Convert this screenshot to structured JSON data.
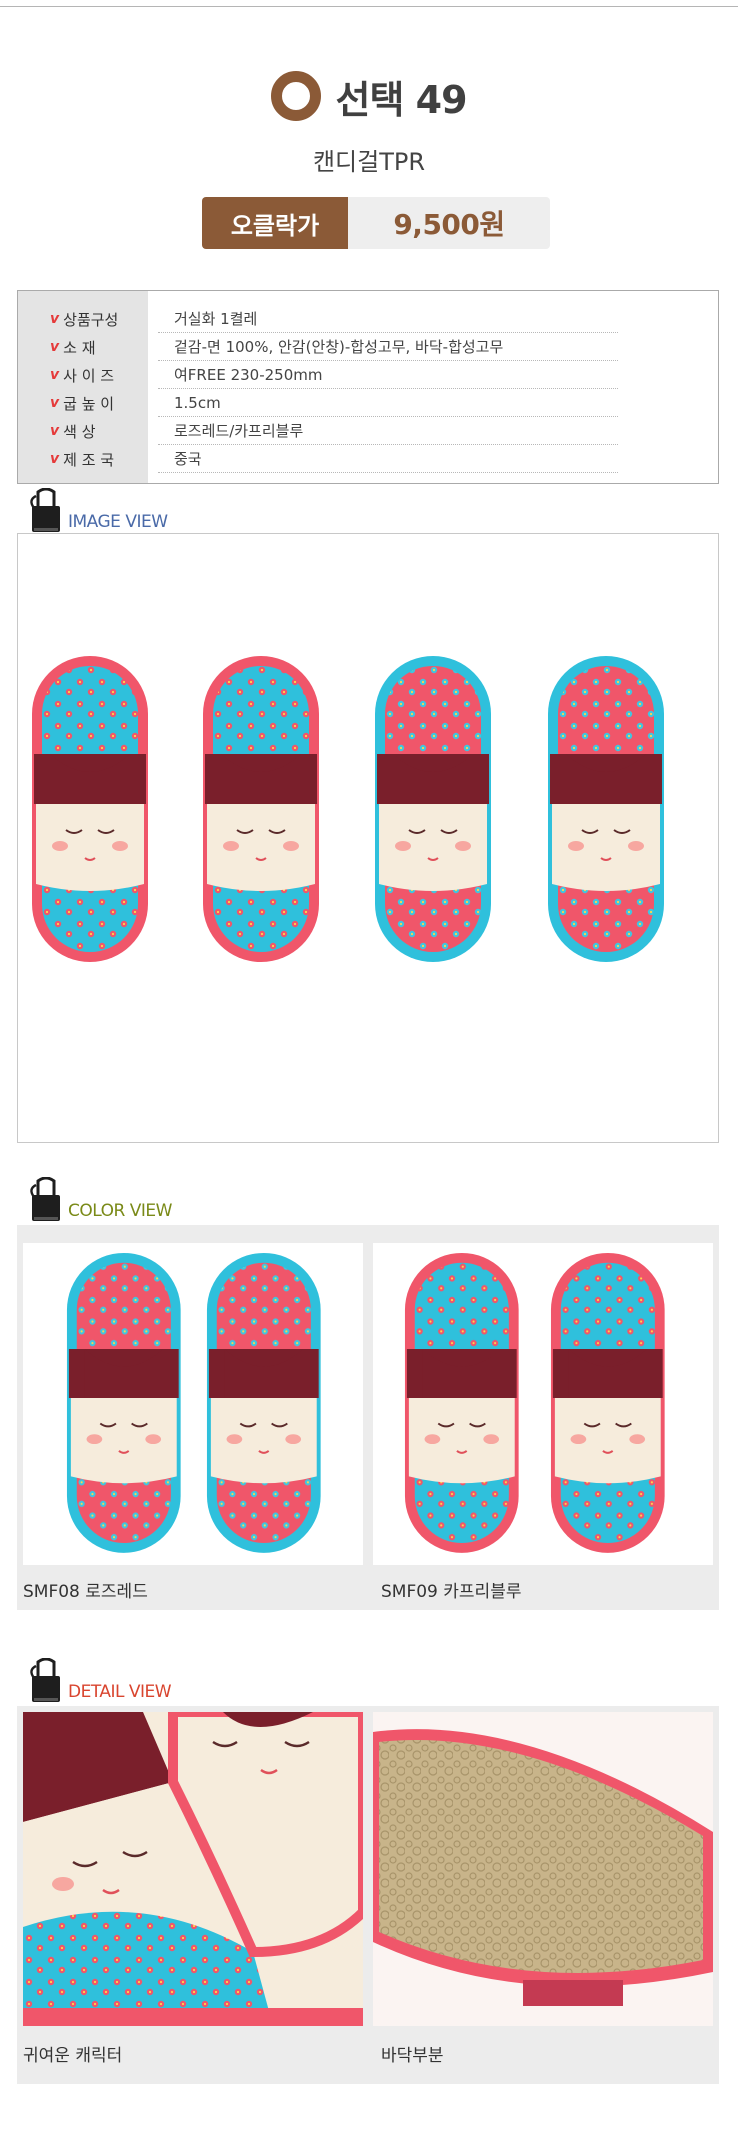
{
  "header": {
    "title": "선택 49",
    "subtitle": "캔디걸TPR",
    "price_label": "오클락가",
    "price_value": "9,500원"
  },
  "specs": [
    {
      "key": "상품구성",
      "value": "거실화 1켤레"
    },
    {
      "key": "소  재",
      "value": "겉감-면 100%, 안감(안창)-합성고무, 바닥-합성고무"
    },
    {
      "key": "사 이 즈",
      "value": "여FREE 230-250mm"
    },
    {
      "key": "굽 높 이",
      "value": "1.5cm"
    },
    {
      "key": "색  상",
      "value": "로즈레드/카프리블루"
    },
    {
      "key": "제 조 국",
      "value": "중국"
    }
  ],
  "sections": {
    "image_view": {
      "title": "IMAGE VIEW",
      "color": "#4a6aa8"
    },
    "color_view": {
      "title": "COLOR VIEW",
      "color": "#7a8a18"
    },
    "detail_view": {
      "title": "DETAIL VIEW",
      "color": "#d9452f"
    }
  },
  "color_view": [
    {
      "caption": "SMF08 로즈레드"
    },
    {
      "caption": "SMF09 카프리블루"
    }
  ],
  "detail_view": [
    {
      "caption": "귀여운 캐릭터"
    },
    {
      "caption": "바닥부분"
    }
  ],
  "colors": {
    "brand_brown": "#8b5a37",
    "rose": "#f0566a",
    "capri_blue": "#2fc0dc",
    "burgundy": "#7a1f2b",
    "cream": "#f6ecdc"
  }
}
